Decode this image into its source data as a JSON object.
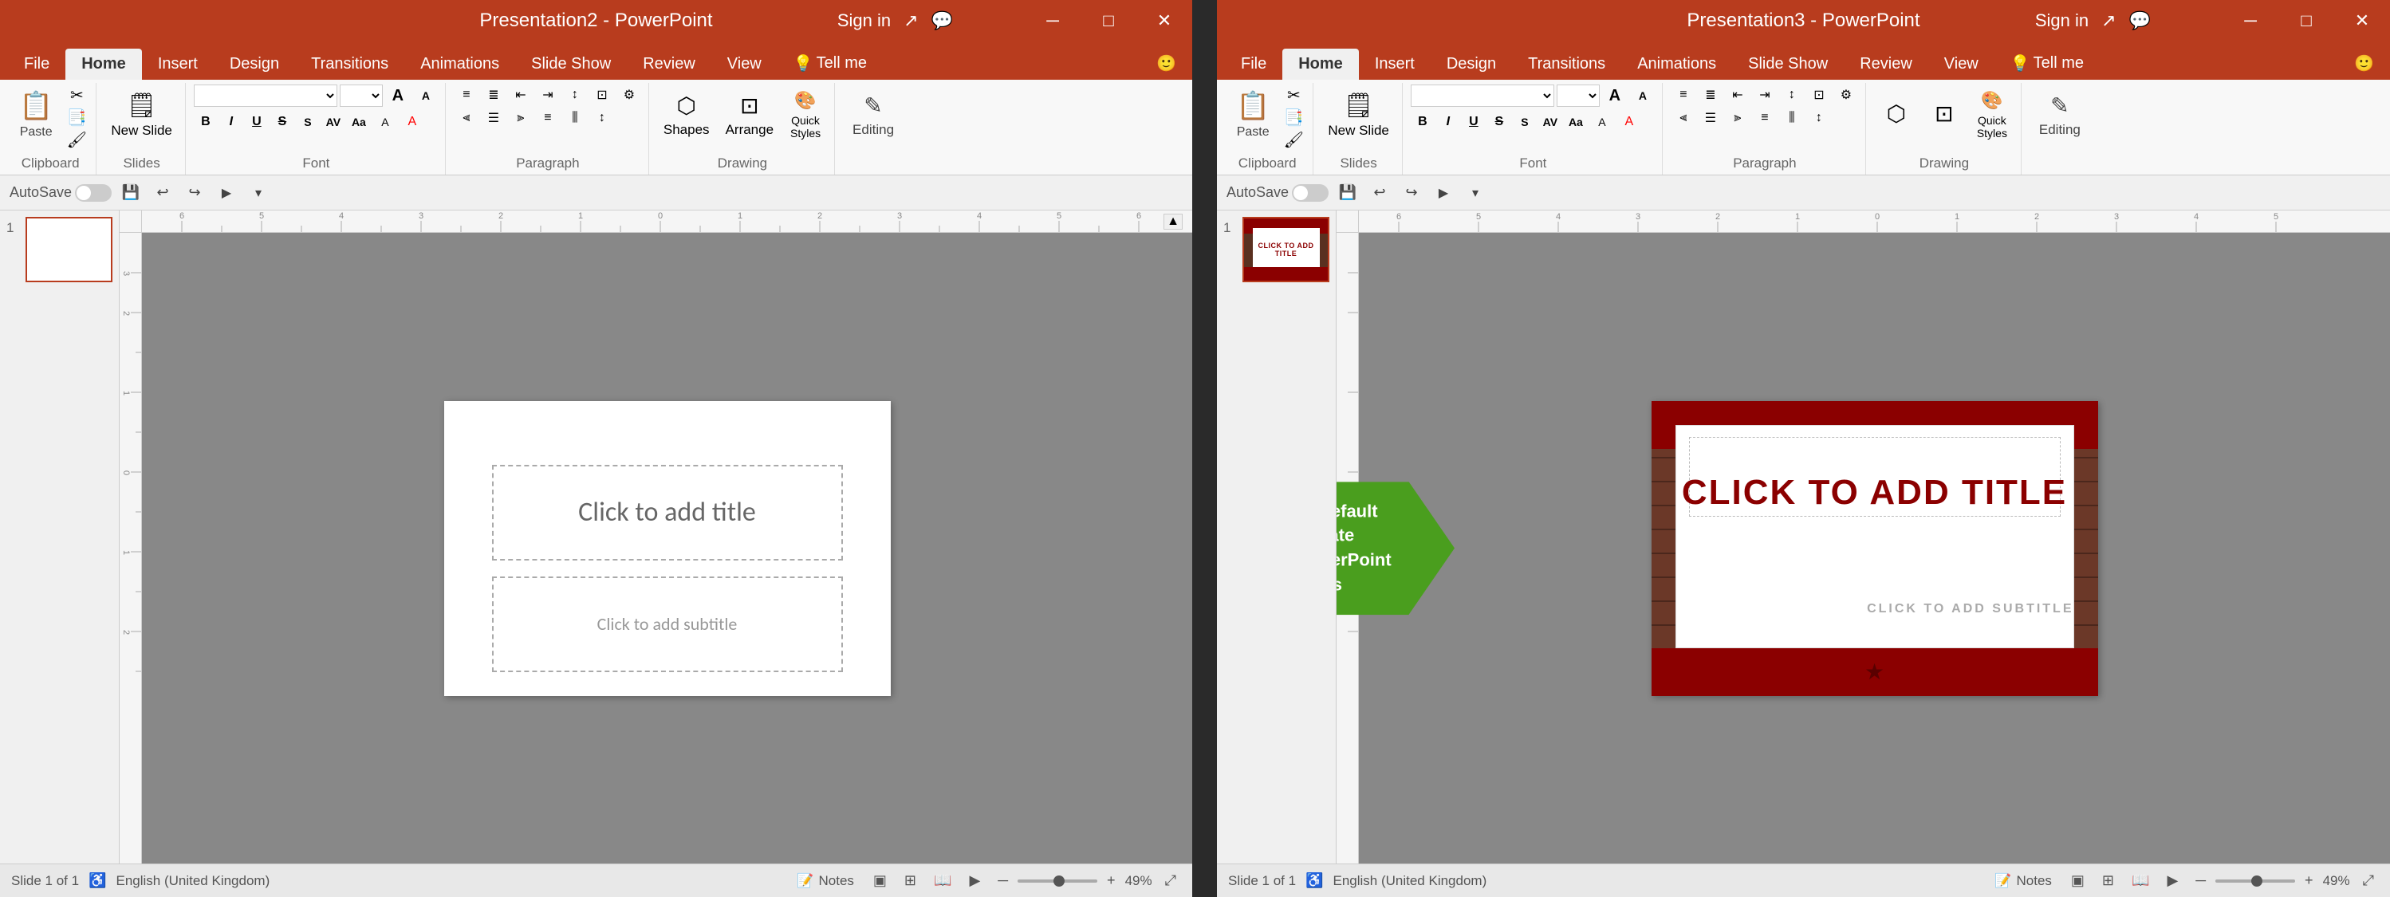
{
  "window_left": {
    "title": "Presentation2 - PowerPoint",
    "signin": "Sign in",
    "tabs": [
      "File",
      "Home",
      "Insert",
      "Design",
      "Transitions",
      "Animations",
      "Slide Show",
      "Review",
      "View",
      "Tell me"
    ],
    "active_tab": "Home",
    "ribbon": {
      "clipboard_label": "Clipboard",
      "slides_label": "Slides",
      "font_label": "Font",
      "paragraph_label": "Paragraph",
      "drawing_label": "Drawing",
      "editing_label": "Editing",
      "paste_label": "Paste",
      "new_slide_label": "New Slide",
      "font_name": "",
      "font_size": "",
      "bold": "B",
      "italic": "I",
      "underline": "U",
      "strikethrough": "S",
      "shapes_label": "Shapes",
      "arrange_label": "Arrange",
      "quick_styles_label": "Quick Styles"
    },
    "quick_access": {
      "autosave": "AutoSave",
      "autosave_on": false
    },
    "slide": {
      "title_placeholder": "Click to add title",
      "subtitle_placeholder": "Click to add subtitle"
    },
    "status_bar": {
      "slide_info": "Slide 1 of 1",
      "language": "English (United Kingdom)",
      "notes": "Notes",
      "zoom": "49%"
    }
  },
  "window_right": {
    "title": "Presentation3 - PowerPoint",
    "signin": "Sign in",
    "tabs": [
      "File",
      "Home",
      "Insert",
      "Design",
      "Transitions",
      "Animations",
      "Slide Show",
      "Review",
      "View",
      "Tell me"
    ],
    "active_tab": "Home",
    "ribbon": {
      "clipboard_label": "Clipboard",
      "slides_label": "Slides",
      "font_label": "Font",
      "paragraph_label": "Paragraph",
      "drawing_label": "Drawing",
      "editing_label": "Editing",
      "paste_label": "Paste",
      "new_slide_label": "New Slide"
    },
    "slide": {
      "title": "CLICK TO ADD TITLE",
      "subtitle": "CLICK TO ADD SUBTITLE"
    },
    "status_bar": {
      "slide_info": "Slide 1 of 1",
      "language": "English (United Kingdom)",
      "notes": "Notes",
      "zoom": "49%"
    }
  },
  "arrow_overlay": {
    "line1": "set the default template",
    "line2": "when PowerPoint starts"
  },
  "icons": {
    "save": "💾",
    "undo": "↩",
    "redo": "↪",
    "more": "⋯",
    "paste": "📋",
    "cut": "✂",
    "copy": "📑",
    "format_painter": "🖌",
    "new_slide": "🗒",
    "bold": "B",
    "italic": "I",
    "underline": "U",
    "shapes": "⬡",
    "arrange": "⊡",
    "editing": "✎",
    "search": "🔍",
    "share": "↗",
    "comment": "💬",
    "minimize": "─",
    "maximize": "□",
    "close": "✕",
    "note": "📝",
    "fit_slide": "⊞",
    "view_normal": "▣",
    "view_outline": "≡",
    "smiley": "🙂",
    "expand": "⤢",
    "arrow_down_small": "▾",
    "slide_sorter": "⊞",
    "reading_view": "📖",
    "notes_icon": "📄"
  },
  "colors": {
    "accent": "#b83c1e",
    "green_arrow": "#4a9e1e",
    "slide_red": "#8b0000",
    "dark_bg": "#2a2a2a"
  }
}
